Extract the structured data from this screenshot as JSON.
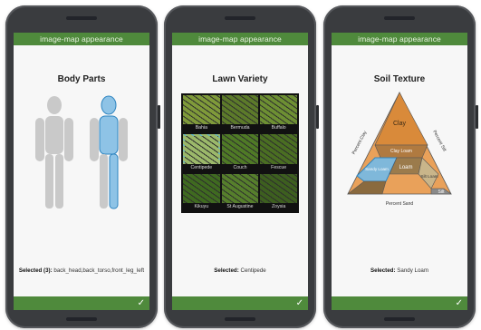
{
  "phones": [
    {
      "header": "image-map appearance",
      "title": "Body Parts",
      "selected_label": "Selected (3):",
      "selected_value": "back_head,back_torso,front_leg_left"
    },
    {
      "header": "image-map appearance",
      "title": "Lawn Variety",
      "selected_label": "Selected:",
      "selected_value": "Centipede",
      "grasses": [
        {
          "name": "Bahia",
          "color": "#7f9a3a",
          "selected": false
        },
        {
          "name": "Bermuda",
          "color": "#5c7a2a",
          "selected": false
        },
        {
          "name": "Buffalo",
          "color": "#6d8f33",
          "selected": false
        },
        {
          "name": "Centipede",
          "color": "#9bb86a",
          "selected": true
        },
        {
          "name": "Couch",
          "color": "#4f7a26",
          "selected": false
        },
        {
          "name": "Fescue",
          "color": "#4a6e22",
          "selected": false
        },
        {
          "name": "Kikuyu",
          "color": "#3f6a20",
          "selected": false
        },
        {
          "name": "St Augustine",
          "color": "#567f2c",
          "selected": false
        },
        {
          "name": "Zoysia",
          "color": "#3d5f1f",
          "selected": false
        }
      ]
    },
    {
      "header": "image-map appearance",
      "title": "Soil Texture",
      "selected_label": "Selected:",
      "selected_value": "Sandy Loam",
      "triangle": {
        "labels": {
          "clay": "Clay",
          "clay_loam": "Clay Loam",
          "sandy_loam": "Sandy Loam",
          "loam": "Loam",
          "silt_loam": "Silt Loam",
          "silt": "Silt",
          "percent_clay": "Percent Clay",
          "percent_silt": "Percent Silt",
          "percent_sand": "Percent Sand"
        }
      }
    }
  ],
  "colors": {
    "accent_green": "#4f8a3c",
    "highlight_blue": "#3ea5d6",
    "body_gray": "#c9c9c9",
    "soil_orange": "#d98a3a",
    "soil_brown": "#8a6a3e"
  },
  "icons": {
    "confirm": "checkmark-icon"
  }
}
